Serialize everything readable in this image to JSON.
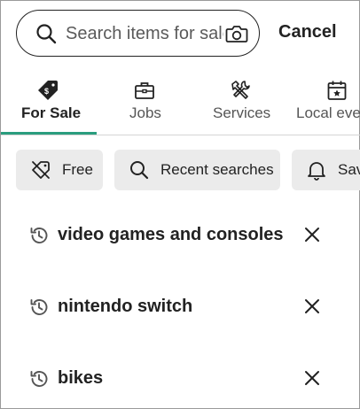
{
  "search": {
    "placeholder": "Search items for sale",
    "value": "",
    "search_icon": "search-icon",
    "camera_icon": "camera-icon"
  },
  "cancel_label": "Cancel",
  "tabs": [
    {
      "label": "For Sale",
      "icon": "price-tag-icon",
      "active": true
    },
    {
      "label": "Jobs",
      "icon": "briefcase-icon",
      "active": false
    },
    {
      "label": "Services",
      "icon": "tools-icon",
      "active": false
    },
    {
      "label": "Local events",
      "icon": "calendar-icon",
      "active": false
    }
  ],
  "chips": [
    {
      "label": "Free",
      "icon": "no-price-tag-icon"
    },
    {
      "label": "Recent searches",
      "icon": "search-icon"
    },
    {
      "label": "Saved",
      "icon": "bell-icon"
    }
  ],
  "recent_searches": [
    {
      "label": "video games and consoles"
    },
    {
      "label": "nintendo switch"
    },
    {
      "label": "bikes"
    }
  ],
  "colors": {
    "accent": "#2a9d7e",
    "chip_bg": "#ebebeb",
    "text": "#222222"
  }
}
